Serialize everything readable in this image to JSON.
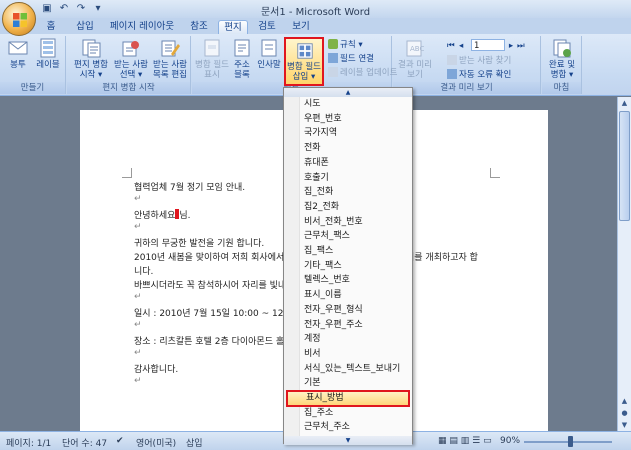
{
  "window": {
    "title": "문서1 - Microsoft Word"
  },
  "tabs": [
    {
      "label": "홈"
    },
    {
      "label": "삽입"
    },
    {
      "label": "페이지 레이아웃"
    },
    {
      "label": "참조"
    },
    {
      "label": "편지"
    },
    {
      "label": "검토"
    },
    {
      "label": "보기"
    }
  ],
  "ribbon": {
    "create": {
      "envelopes": "봉투",
      "labels": "레이블",
      "group": "만들기"
    },
    "start_merge": {
      "start_line1": "편지 병합",
      "start_line2": "시작 ▾",
      "select_line1": "받는 사람",
      "select_line2": "선택 ▾",
      "edit_line1": "받는 사람",
      "edit_line2": "목록 편집",
      "group": "편지 병합 시작"
    },
    "fields": {
      "highlight_line1": "병합 필드",
      "highlight_line2": "표시",
      "address_line1": "주소",
      "address_line2": "블록",
      "greeting": "인사말",
      "insert_line1": "병합 필드",
      "insert_line2": "삽입 ▾",
      "rules": "규칙 ▾",
      "match": "필드 연결",
      "update": "레이블 업데이트",
      "group": "필드"
    },
    "preview": {
      "preview_line1": "결과 미리",
      "preview_line2": "보기",
      "record": "1",
      "find": "받는 사람 찾기",
      "auto_check": "자동 오류 확인",
      "group": "결과 미리 보기"
    },
    "finish": {
      "finish_line1": "완료 및",
      "finish_line2": "병합 ▾",
      "group": "마침"
    }
  },
  "document": {
    "lines": [
      "협력업체 7월 정기 모임 안내.",
      "↵",
      "안녕하세요",
      "↵",
      "귀하의 무궁한 발전을 기원 합니다.",
      "2010년 새봄을 맞이하여 저희 회사에서는",
      "니다.",
      "바쁘시더라도 꼭 참석하시어 자리를 빛내",
      "↵",
      "일시 : 2010년 7월 15일 10:00 ~ 12:00.",
      "↵",
      "장소 : 리츠칼튼 호텔 2층 다이아몬드 홀.",
      "↵",
      "감사합니다.",
      "↵"
    ],
    "greeting_suffix": "님.",
    "right_fragment": "의를 개최하고자 합"
  },
  "dropdown": {
    "items": [
      "시도",
      "우편_번호",
      "국가지역",
      "전화",
      "휴대폰",
      "호출기",
      "집_전화",
      "집2_전화",
      "비서_전화_번호",
      "근무처_팩스",
      "집_팩스",
      "기타_팩스",
      "텔렉스_번호",
      "표시_이름",
      "전자_우편_형식",
      "전자_우편_주소",
      "계정",
      "비서",
      "서식_있는_텍스트_보내기",
      "기본",
      "표시_방법",
      "집_주소",
      "근무처_주소"
    ],
    "selected": "표시_방법"
  },
  "statusbar": {
    "page": "페이지: 1/1",
    "words": "단어 수: 47",
    "language": "영어(미국)",
    "mode": "삽입",
    "zoom": "90%"
  }
}
